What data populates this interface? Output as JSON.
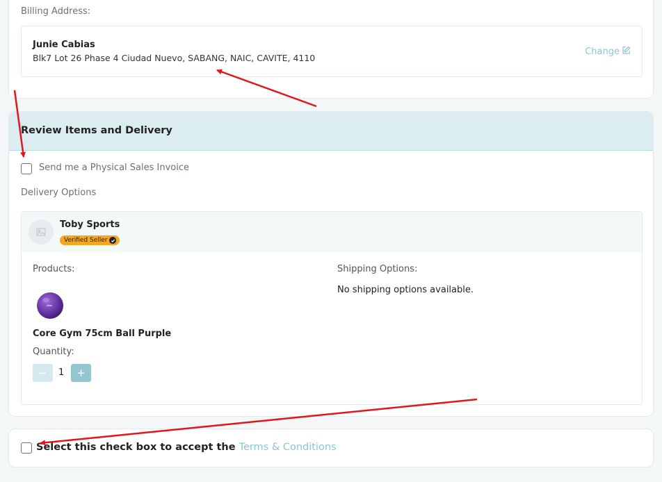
{
  "billing": {
    "label": "Billing Address:",
    "name": "Junie Cabias",
    "address": "Blk7 Lot 26 Phase 4 Ciudad Nuevo, SABANG, NAIC, CAVITE, 4110",
    "change_label": "Change",
    "change_icon": "edit-icon"
  },
  "review": {
    "title": "Review Items and Delivery",
    "invoice_label": "Send me a Physical Sales Invoice",
    "delivery_label": "Delivery Options",
    "seller": {
      "name": "Toby Sports",
      "badge": "Verified Seller",
      "avatar_icon": "image-placeholder-icon"
    },
    "products_label": "Products:",
    "shipping_label": "Shipping Options:",
    "shipping_message": "No shipping options available.",
    "product": {
      "name": "Core Gym 75cm Ball Purple",
      "quantity_label": "Quantity:",
      "quantity": "1",
      "minus": "−",
      "plus": "+"
    }
  },
  "terms": {
    "prefix": "Select this check box to accept the ",
    "link": "Terms & Conditions"
  },
  "colors": {
    "accent": "#8cc6cf",
    "header_bg": "#dcedf1",
    "badge": "#f5a623",
    "arrow": "#e3151a"
  }
}
